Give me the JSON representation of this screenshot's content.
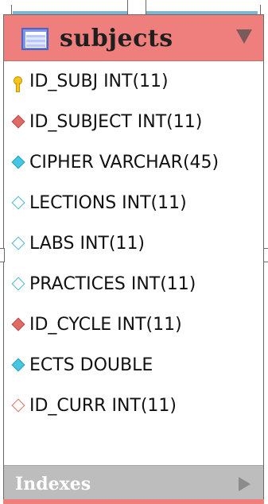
{
  "table": {
    "name": "subjects",
    "columns": [
      {
        "label": "ID_SUBJ INT(11)",
        "icon": "primary-key-icon"
      },
      {
        "label": "ID_SUBJECT INT(11)",
        "icon": "foreign-key-diamond-icon"
      },
      {
        "label": "CIPHER VARCHAR(45)",
        "icon": "not-null-diamond-icon"
      },
      {
        "label": "LECTIONS INT(11)",
        "icon": "nullable-diamond-icon"
      },
      {
        "label": "LABS INT(11)",
        "icon": "nullable-diamond-icon"
      },
      {
        "label": "PRACTICES INT(11)",
        "icon": "nullable-diamond-icon"
      },
      {
        "label": "ID_CYCLE INT(11)",
        "icon": "foreign-key-diamond-icon"
      },
      {
        "label": "ECTS DOUBLE",
        "icon": "not-null-diamond-icon"
      },
      {
        "label": "ID_CURR INT(11)",
        "icon": "nullable-foreign-key-diamond-icon"
      }
    ],
    "indexes_label": "Indexes"
  },
  "colors": {
    "header": "#ef7f7c",
    "indexes_bar": "#bdbdbd",
    "top_strip": "#7fb6cf"
  }
}
